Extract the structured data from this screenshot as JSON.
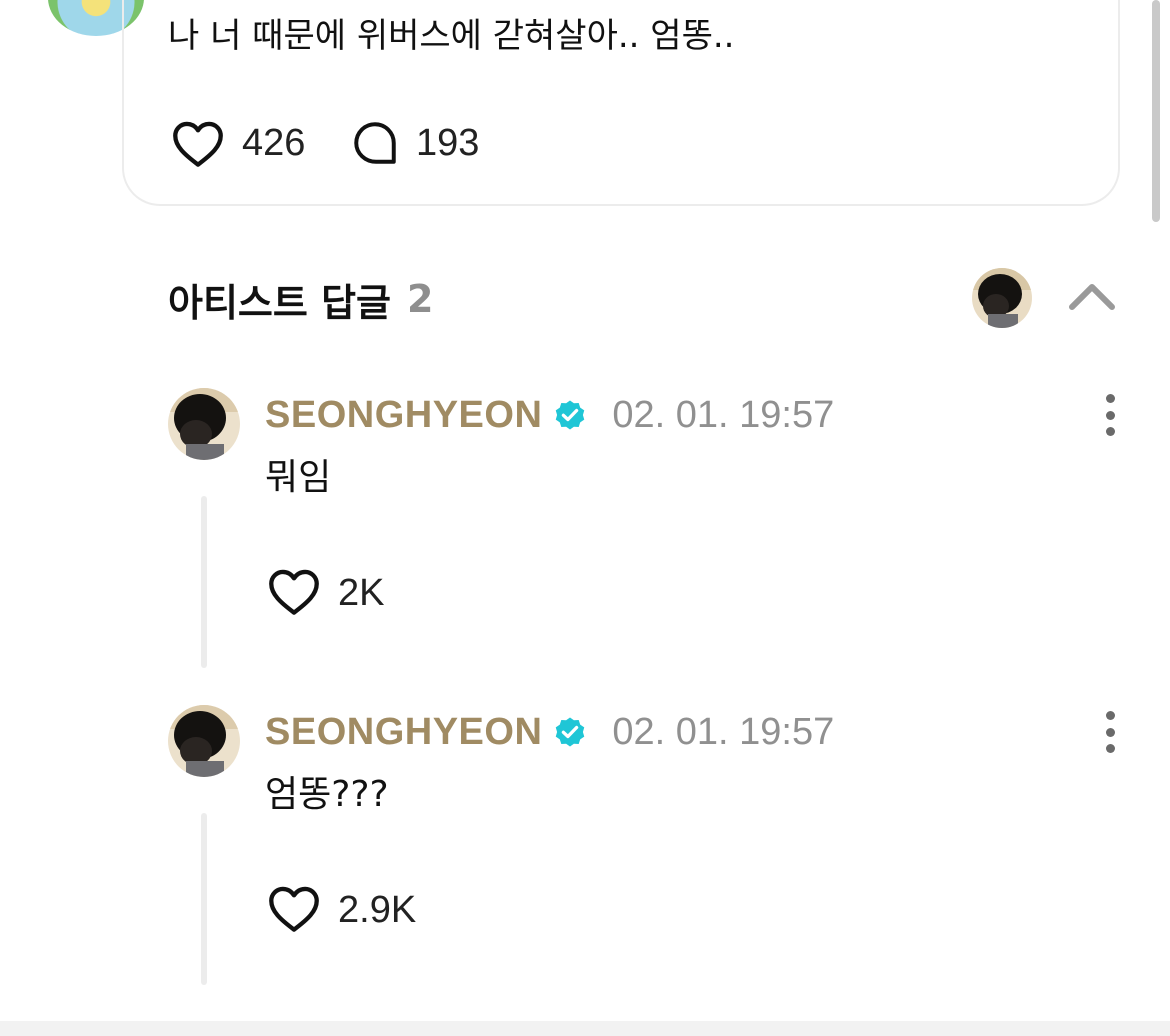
{
  "post": {
    "text": "나 너 때문에 위버스에 갇혀살아.. 엄똥..",
    "likes": "426",
    "comments": "193"
  },
  "artist_replies": {
    "title": "아티스트 답글",
    "count": "2"
  },
  "replies": [
    {
      "author": "SEONGHYEON",
      "time": "02. 01. 19:57",
      "text": "뭐임",
      "likes": "2K"
    },
    {
      "author": "SEONGHYEON",
      "time": "02. 01. 19:57",
      "text": "엄똥???",
      "likes": "2.9K"
    }
  ],
  "colors": {
    "author": "#a08b63",
    "verified": "#1fc6d6",
    "muted": "#909090",
    "divider": "#ececec"
  },
  "icons": [
    "heart-icon",
    "comment-icon",
    "chevron-up-icon",
    "verified-badge-icon",
    "more-vertical-icon"
  ]
}
